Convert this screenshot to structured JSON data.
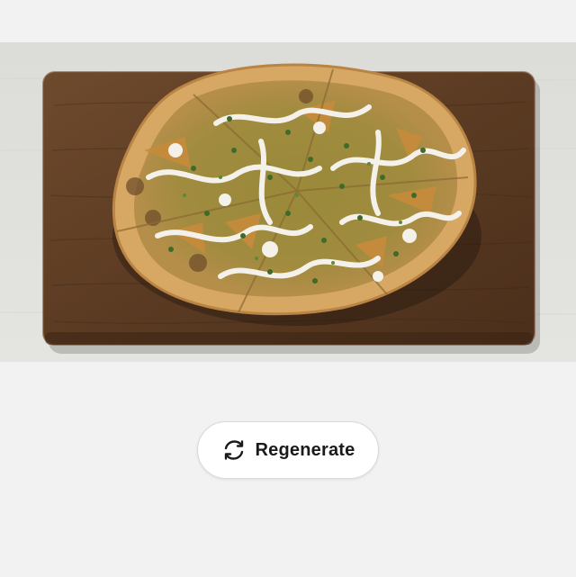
{
  "regenerate_button": {
    "label": "Regenerate",
    "icon": "refresh-icon"
  },
  "image": {
    "subject": "pizza-on-wooden-board-icon"
  },
  "colors": {
    "page_background": "#f2f2f2",
    "button_background": "#ffffff",
    "button_text": "#1a1a1a",
    "board": "#5a3a22",
    "crust": "#d9a862",
    "cream": "#f4f1ea",
    "herbs": "#3f6b2a"
  }
}
